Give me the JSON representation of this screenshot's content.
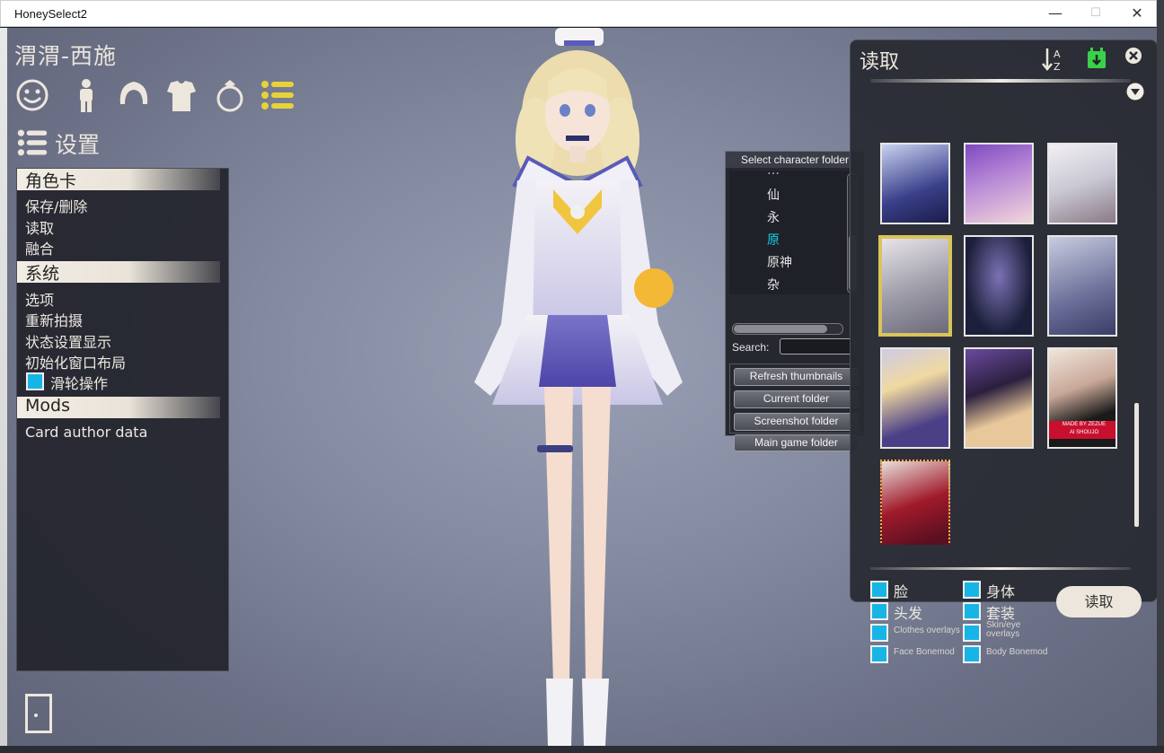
{
  "window": {
    "title": "HoneySelect2",
    "minimize": "—",
    "maximize": "☐",
    "close": "✕"
  },
  "character_name": "渭渭-西施",
  "category_icons": [
    "face-icon",
    "body-icon",
    "hair-icon",
    "clothes-icon",
    "accessory-icon",
    "list-icon"
  ],
  "settings_header": "设置",
  "left_menu": {
    "sections": [
      {
        "title": "角色卡",
        "items": [
          "保存/删除",
          "读取",
          "融合"
        ]
      },
      {
        "title": "系统",
        "items": [
          "选项",
          "重新拍摄",
          "状态设置显示",
          "初始化窗口布局"
        ],
        "checkbox_item": "滑轮操作"
      },
      {
        "title": "Mods",
        "items": [
          "Card author data"
        ]
      }
    ]
  },
  "folder_dialog": {
    "title": "Select character folder",
    "tree_items": [
      "仙",
      "永",
      "原",
      "原神",
      "杂"
    ],
    "selected_item": "原",
    "search_label": "Search:",
    "search_value": "",
    "buttons": [
      "Refresh thumbnails",
      "Current folder",
      "Screenshot folder",
      "Main game folder"
    ]
  },
  "load_panel": {
    "title": "读取",
    "options": [
      {
        "label": "脸",
        "size": "big"
      },
      {
        "label": "身体",
        "size": "big"
      },
      {
        "label": "头发",
        "size": "big"
      },
      {
        "label": "套装",
        "size": "big"
      },
      {
        "label": "Clothes overlays",
        "size": "sm"
      },
      {
        "label": "Skin/eye overlays",
        "size": "sm"
      },
      {
        "label": "Face Bonemod",
        "size": "sm"
      },
      {
        "label": "Body Bonemod",
        "size": "sm"
      }
    ],
    "load_button": "读取",
    "card_text_line1": "MADE BY ZEZUE",
    "card_text_line2": "AI SHOUJO"
  },
  "colors": {
    "accent_checkbox": "#17b5e6",
    "selected_folder": "#18d0e6",
    "icon_yellow": "#e8d23a",
    "load_icon_green": "#3ad04a"
  }
}
